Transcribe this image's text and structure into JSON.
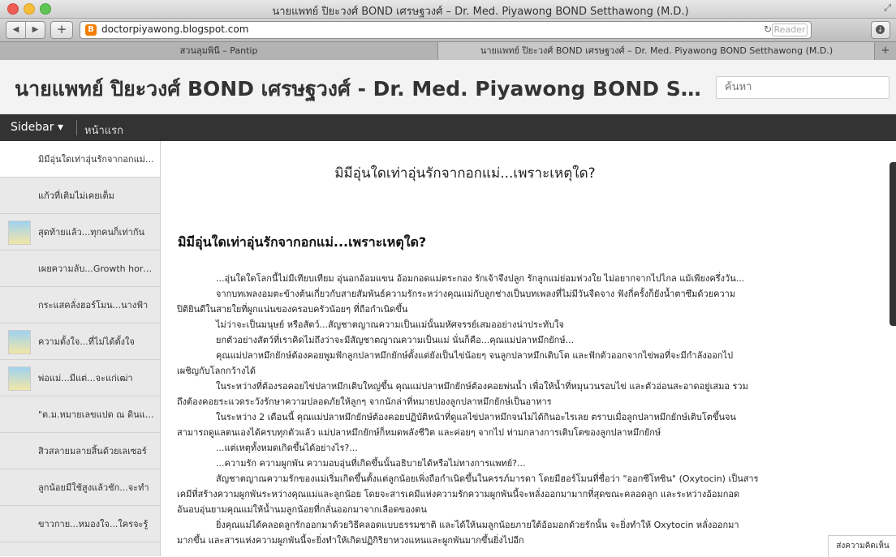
{
  "window": {
    "title": "นายแพทย์ ปิยะวงศ์ BOND เศรษฐวงศ์ – Dr. Med. Piyawong BOND Setthawong (M.D.)"
  },
  "toolbar": {
    "back": "◀",
    "forward": "▶",
    "add": "+",
    "url": "doctorpiyawong.blogspot.com",
    "reload": "↻",
    "reader": "Reader",
    "download": "↓",
    "favicon": "B"
  },
  "tabs": [
    {
      "label": "สวนลุมพินี – Pantip"
    },
    {
      "label": "นายแพทย์ ปิยะวงศ์ BOND เศรษฐวงศ์ – Dr. Med. Piyawong BOND Setthawong (M.D.)"
    }
  ],
  "blog": {
    "title": "นายแพทย์ ปิยะวงศ์ BOND เศรษฐวงศ์ - Dr. Med. Piyawong BOND Setthawong (M.D.)",
    "search_placeholder": "ค้นหา"
  },
  "nav": {
    "sidebar_label": "Sidebar ▾",
    "home_label": "หน้าแรก"
  },
  "sidebar": {
    "items": [
      {
        "label": "มิมีอุ่นใดเท่าอุ่นรักจากอกแม่...เพราะเหตุใด?",
        "thumb": false,
        "active": true
      },
      {
        "label": "แก้วที่เติมไม่เคยเต็ม",
        "thumb": false,
        "active": false
      },
      {
        "label": "สุดท้ายแล้ว...ทุกคนก็เท่ากัน",
        "thumb": true,
        "active": false
      },
      {
        "label": "เผยความลับ...Growth hormone",
        "thumb": false,
        "active": false
      },
      {
        "label": "กระแสคลั่งฮอร์โมน...นางฟ้า",
        "thumb": false,
        "active": false
      },
      {
        "label": "ความตั้งใจ...ที่ไม่ได้ตั้งใจ",
        "thumb": true,
        "active": false
      },
      {
        "label": "พ่อแม่...มีแต่...จะแก่เฒ่า",
        "thumb": true,
        "active": false
      },
      {
        "label": "\"ต.ม.หมายเลขแปด ณ ดินแดน",
        "thumb": false,
        "active": false
      },
      {
        "label": "สิวสลายมลายสิ้นด้วยเลเซอร์",
        "thumb": false,
        "active": false
      },
      {
        "label": "ลูกน้อยมีใช้สูงแล้วชัก...จะทำ",
        "thumb": false,
        "active": false
      },
      {
        "label": "ขาวกาย...หมองใจ...ใครจะรู้",
        "thumb": false,
        "active": false
      }
    ]
  },
  "post": {
    "header": "มิมีอุ่นใดเท่าอุ่นรักจากอกแม่...เพราะเหตุใด?",
    "title": "มิมีอุ่นใดเท่าอุ่นรักจากอกแม่...เพราะเหตุใด?",
    "paragraphs": [
      "...อุ่นใดใดโลกนี้ไม่มีเทียบเทียม อุ่นอกอ้อมแขน อ้อมกอดแม่ตระกอง รักเจ้าจึงปลูก รักลูกแม่ย่อมห่วงใย ไม่อยากจากไปไกล แม้เพียงครึ่งวัน...",
      "จากบทเพลงอมตะข้างต้นเกี่ยวกับสายสัมพันธ์ความรักระหว่างคุณแม่กับลูกช่างเป็นบทเพลงที่ไม่มีวันจืดจาง  ฟังกี่ครั้งก็ยังน้ำตาซึมด้วยความ",
      "ปิติยินดีในสายใยที่ผูกแน่นของครอบครัวน้อยๆ ที่ถือกำเนิดขึ้น",
      "ไม่ว่าจะเป็นมนุษย์ หรือสัตว์...สัญชาตญาณความเป็นแม่นั้นมหัศจรรย์เสมออย่างน่าประทับใจ",
      "ยกตัวอย่างสัตว์ที่เราคิดไม่ถึงว่าจะมีสัญชาตญาณความเป็นแม่ นั่นก็คือ...คุณแม่ปลาหมึกยักษ์...",
      "คุณแม่ปลาหมึกยักษ์ต้องคอยพูมฟักลูกปลาหมึกยักษ์ตั้งแต่ยังเป็นไข่น้อยๆ จนลูกปลาหมึกเติบโต และฟักตัวออกจากไข่พอที่จะมีกำลังออกไป",
      "เผชิญกับโลกกว้างได้",
      "ในระหว่างที่ต้องรอคอยไข่ปลาหมึกเติบใหญ่ขึ้น คุณแม่ปลาหมึกยักษ์ต้องคอยพ่นน้ำ เพื่อให้น้ำที่หมุนวนรอบไข่ และตัวอ่อนสะอาดอยู่เสมอ รวม",
      "ถึงต้องคอยระแวดระวังรักษาความปลอดภัยให้ลูกๆ จากนักล่าที่หมายปองลูกปลาหมึกยักษ์เป็นอาหาร",
      "ในระหว่าง 2 เดือนนี้ คุณแม่ปลาหมึกยักษ์ต้องคอยปฏิบัติหน้าที่ดูแลไข่ปลาหมึกจนไม่ได้กินอะไรเลย ตราบเมื่อลูกปลาหมึกยักษ์เติบโตขึ้นจน",
      "สามารถดูแลตนเองได้ครบทุกตัวแล้ว แม่ปลาหมึกยักษ์ก็หมดพลังชีวิต และค่อยๆ จากไป ท่ามกลางการเติบโตของลูกปลาหมึกยักษ์",
      "...แต่เหตุทั้งหมดเกิดขึ้นได้อย่างไร?...",
      "...ความรัก ความผูกพัน ความอบอุ่นที่เกิดขึ้นนั้นอธิบายได้หรือไม่ทางการแพทย์?...",
      "สัญชาตญาณความรักของแม่เริ่มเกิดขึ้นตั้งแต่ลูกน้อยเพิ่งถือกำเนิดขึ้นในครรภ์มารดา โดยมีฮอร์โมนที่ชื่อว่า \"ออกซีโทซิน\" (Oxytocin) เป็นสาร",
      "เคมีที่สร้างความผูกพันระหว่างคุณแม่และลูกน้อย โดยจะสารเคมีแห่งความรักความผูกพันนี้จะหลั่งออกมามากที่สุดขณะคลอดลูก และระหว่างอ้อมกอด",
      "อันอบอุ่นยามคุณแม่ให้น้ำนมลูกน้อยที่กลั่นออกมาจากเลือดของตน",
      "ยิ่งคุณแม่ได้คลอดลูกรักออกมาด้วยวิธีคลอดแบบธรรมชาติ และได้ให้นมลูกน้อยภายใต้อ้อมอกด้วยรักนั้น จะยิ่งทำให้ Oxytocin หลั่งออกมา",
      "มากขึ้น และสารแห่งความผูกพันนี้จะยิ่งทำให้เกิดปฏิกิริยาหวงแหนและผูกพันมากขึ้นยิ่งไปอีก"
    ]
  },
  "comments_tab": "ส่งความคิดเห็น"
}
